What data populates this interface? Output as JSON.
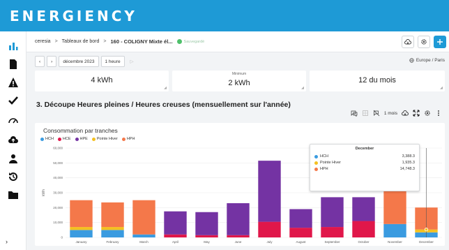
{
  "app": {
    "logo_text": "ENERGIENCY"
  },
  "breadcrumb": {
    "items": [
      "ceresia",
      "Tableaux de bord",
      "160 - COLIGNY Mixte él..."
    ],
    "separator": ">",
    "saved_label": "Sauvegardé"
  },
  "datebar": {
    "period": "décembre 2023",
    "granularity": "1 heure",
    "timezone": "Europe / Paris"
  },
  "kpis": [
    {
      "label": "",
      "value": "4 kWh"
    },
    {
      "label": "Minimum",
      "value": "2 kWh"
    },
    {
      "label": "",
      "value": "12 du mois"
    }
  ],
  "section": {
    "title": "3. Découpe Heures pleines / Heures creuses (mensuellement sur l'année)"
  },
  "chart_tools": {
    "period": "1 mois"
  },
  "chart_data": {
    "type": "bar",
    "stacked": true,
    "title": "Consommation par tranches",
    "ylabel": "kWh",
    "ylim": [
      0,
      60000
    ],
    "yticks": [
      "0",
      "10,000",
      "20,000",
      "30,000",
      "40,000",
      "50,000",
      "60,000"
    ],
    "categories": [
      "January",
      "February",
      "March",
      "April",
      "May",
      "June",
      "July",
      "August",
      "September",
      "October",
      "November",
      "December"
    ],
    "series": [
      {
        "name": "HCH",
        "color": "#3a9be0",
        "values": [
          5000,
          5000,
          2000,
          0,
          0,
          0,
          0,
          0,
          0,
          0,
          9000,
          3388.3
        ]
      },
      {
        "name": "HCE",
        "color": "#e0174a",
        "values": [
          0,
          0,
          0,
          2000,
          1500,
          1500,
          10500,
          6500,
          7000,
          11000,
          0,
          0
        ]
      },
      {
        "name": "HPE",
        "color": "#7433a3",
        "values": [
          0,
          0,
          0,
          15500,
          15500,
          21500,
          41000,
          12500,
          20000,
          16000,
          0,
          0
        ]
      },
      {
        "name": "Pointe Hiver",
        "color": "#f4c020",
        "values": [
          2000,
          2000,
          0,
          0,
          0,
          0,
          0,
          0,
          0,
          0,
          0,
          1935.3
        ]
      },
      {
        "name": "HPH",
        "color": "#f4784a",
        "values": [
          18000,
          16500,
          23000,
          0,
          0,
          0,
          0,
          0,
          0,
          0,
          23500,
          14748.3
        ]
      }
    ]
  },
  "tooltip": {
    "title": "December",
    "rows": [
      {
        "name": "HCH",
        "value": "3,388.3",
        "color": "#3a9be0"
      },
      {
        "name": "Pointe Hiver",
        "value": "1,935.3",
        "color": "#f4c020"
      },
      {
        "name": "HPH",
        "value": "14,748.3",
        "color": "#f4784a"
      }
    ]
  },
  "colors": {
    "brand": "#1e9ad6",
    "saved": "#4fc06b"
  }
}
